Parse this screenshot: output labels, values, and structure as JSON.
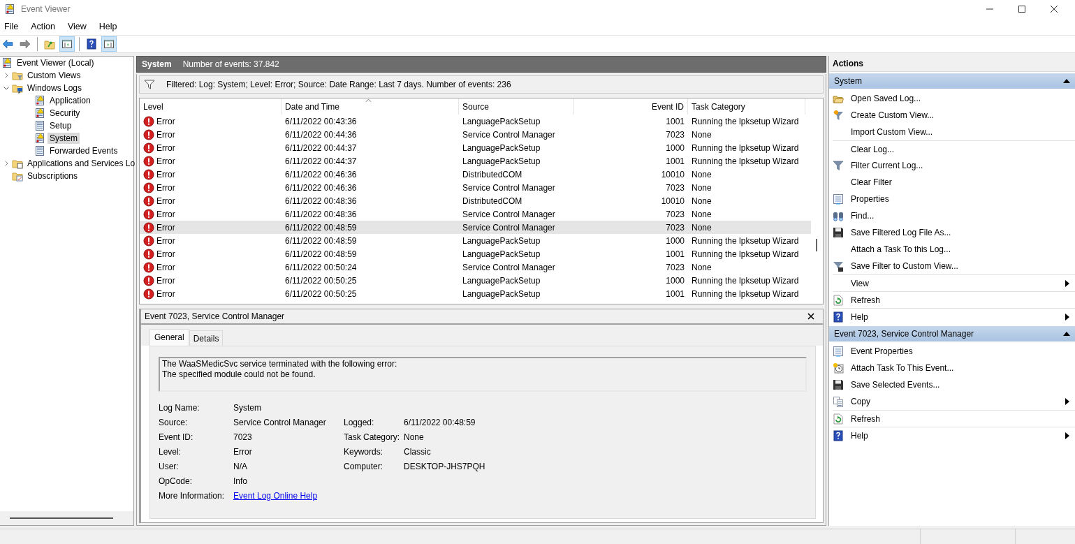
{
  "window": {
    "title": "Event Viewer"
  },
  "menu": [
    "File",
    "Action",
    "View",
    "Help"
  ],
  "toolbar": [
    {
      "kind": "back",
      "pressed": false
    },
    {
      "kind": "forward",
      "pressed": false
    },
    {
      "kind": "separator"
    },
    {
      "kind": "up",
      "pressed": false
    },
    {
      "kind": "tree",
      "pressed": true
    },
    {
      "kind": "separator"
    },
    {
      "kind": "help",
      "pressed": false
    },
    {
      "kind": "actions",
      "pressed": true
    }
  ],
  "tree": [
    {
      "label": "Event Viewer (Local)",
      "kind": "root",
      "selected": false,
      "children": [
        {
          "label": "Custom Views",
          "kind": "filterfolder",
          "expanded": false,
          "selected": false
        },
        {
          "label": "Windows Logs",
          "kind": "logfolder",
          "expanded": true,
          "selected": false,
          "children": [
            {
              "label": "Application",
              "kind": "warnlog",
              "selected": false
            },
            {
              "label": "Security",
              "kind": "warnlog",
              "selected": false
            },
            {
              "label": "Setup",
              "kind": "log",
              "selected": false
            },
            {
              "label": "System",
              "kind": "warnlog",
              "selected": true
            },
            {
              "label": "Forwarded Events",
              "kind": "log",
              "selected": false
            }
          ]
        },
        {
          "label": "Applications and Services Lo",
          "kind": "appfolder",
          "expanded": false,
          "selected": false
        },
        {
          "label": "Subscriptions",
          "kind": "subfolder",
          "selected": false
        }
      ]
    }
  ],
  "log_header": {
    "name": "System",
    "count": "Number of events: 37.842"
  },
  "filter_text": "Filtered: Log: System; Level: Error; Source: Date Range: Last 7 days. Number of events: 236",
  "table": {
    "columns": [
      {
        "label": "Level",
        "sorted": false
      },
      {
        "label": "Date and Time",
        "sorted": true
      },
      {
        "label": "Source",
        "sorted": false
      },
      {
        "label": "Event ID",
        "sorted": false
      },
      {
        "label": "Task Category",
        "sorted": false
      }
    ],
    "rows": [
      {
        "level": "Error",
        "date": "6/11/2022 00:43:36",
        "source": "LanguagePackSetup",
        "id": "1001",
        "category": "Running the lpksetup Wizard",
        "selected": false
      },
      {
        "level": "Error",
        "date": "6/11/2022 00:44:36",
        "source": "Service Control Manager",
        "id": "7023",
        "category": "None",
        "selected": false
      },
      {
        "level": "Error",
        "date": "6/11/2022 00:44:37",
        "source": "LanguagePackSetup",
        "id": "1000",
        "category": "Running the lpksetup Wizard",
        "selected": false
      },
      {
        "level": "Error",
        "date": "6/11/2022 00:44:37",
        "source": "LanguagePackSetup",
        "id": "1001",
        "category": "Running the lpksetup Wizard",
        "selected": false
      },
      {
        "level": "Error",
        "date": "6/11/2022 00:46:36",
        "source": "DistributedCOM",
        "id": "10010",
        "category": "None",
        "selected": false
      },
      {
        "level": "Error",
        "date": "6/11/2022 00:46:36",
        "source": "Service Control Manager",
        "id": "7023",
        "category": "None",
        "selected": false
      },
      {
        "level": "Error",
        "date": "6/11/2022 00:48:36",
        "source": "DistributedCOM",
        "id": "10010",
        "category": "None",
        "selected": false
      },
      {
        "level": "Error",
        "date": "6/11/2022 00:48:36",
        "source": "Service Control Manager",
        "id": "7023",
        "category": "None",
        "selected": false
      },
      {
        "level": "Error",
        "date": "6/11/2022 00:48:59",
        "source": "Service Control Manager",
        "id": "7023",
        "category": "None",
        "selected": true
      },
      {
        "level": "Error",
        "date": "6/11/2022 00:48:59",
        "source": "LanguagePackSetup",
        "id": "1000",
        "category": "Running the lpksetup Wizard",
        "selected": false
      },
      {
        "level": "Error",
        "date": "6/11/2022 00:48:59",
        "source": "LanguagePackSetup",
        "id": "1001",
        "category": "Running the lpksetup Wizard",
        "selected": false
      },
      {
        "level": "Error",
        "date": "6/11/2022 00:50:24",
        "source": "Service Control Manager",
        "id": "7023",
        "category": "None",
        "selected": false
      },
      {
        "level": "Error",
        "date": "6/11/2022 00:50:25",
        "source": "LanguagePackSetup",
        "id": "1000",
        "category": "Running the lpksetup Wizard",
        "selected": false
      },
      {
        "level": "Error",
        "date": "6/11/2022 00:50:25",
        "source": "LanguagePackSetup",
        "id": "1001",
        "category": "Running the lpksetup Wizard",
        "selected": false
      }
    ]
  },
  "details": {
    "title": "Event 7023, Service Control Manager",
    "tabs": [
      {
        "label": "General",
        "selected": true
      },
      {
        "label": "Details",
        "selected": false
      }
    ],
    "message": [
      "The WaaSMedicSvc service terminated with the following error:",
      "The specified module could not be found."
    ],
    "rows": [
      {
        "label": "Log Name:",
        "value": "System"
      },
      {
        "label": "Source:",
        "value": "Service Control Manager",
        "label_2": "Logged:",
        "value_2": "6/11/2022 00:48:59"
      },
      {
        "label": "Event ID:",
        "value": "7023",
        "label_2": "Task Category:",
        "value_2": "None"
      },
      {
        "label": "Level:",
        "value": "Error",
        "label_2": "Keywords:",
        "value_2": "Classic"
      },
      {
        "label": "User:",
        "value": "N/A",
        "label_2": "Computer:",
        "value_2": "DESKTOP-JHS7PQH"
      },
      {
        "label": "OpCode:",
        "value": "Info"
      }
    ],
    "more_info": {
      "label": "More Information:",
      "link": "Event Log Online Help"
    }
  },
  "actions": {
    "title": "Actions",
    "sections": [
      {
        "title": "System",
        "expanded": true,
        "items": [
          {
            "label": "Open Saved Log...",
            "kind": "folder",
            "submenu": false,
            "separator_before": false
          },
          {
            "label": "Create Custom View...",
            "kind": "funnelstar",
            "submenu": false,
            "separator_before": false
          },
          {
            "label": "Import Custom View...",
            "kind": "none",
            "submenu": false,
            "separator_before": false
          },
          {
            "label": "Clear Log...",
            "kind": "none",
            "submenu": false,
            "separator_before": true
          },
          {
            "label": "Filter Current Log...",
            "kind": "funnel",
            "submenu": false,
            "separator_before": false
          },
          {
            "label": "Clear Filter",
            "kind": "none",
            "submenu": false,
            "separator_before": false
          },
          {
            "label": "Properties",
            "kind": "properties",
            "submenu": false,
            "separator_before": false
          },
          {
            "label": "Find...",
            "kind": "binoculars",
            "submenu": false,
            "separator_before": false
          },
          {
            "label": "Save Filtered Log File As...",
            "kind": "disk",
            "submenu": false,
            "separator_before": false
          },
          {
            "label": "Attach a Task To this Log...",
            "kind": "none",
            "submenu": false,
            "separator_before": false
          },
          {
            "label": "Save Filter to Custom View...",
            "kind": "funneldisk",
            "submenu": false,
            "separator_before": false
          },
          {
            "label": "View",
            "kind": "none",
            "submenu": true,
            "separator_before": true
          },
          {
            "label": "Refresh",
            "kind": "refresh",
            "submenu": false,
            "separator_before": true
          },
          {
            "label": "Help",
            "kind": "help",
            "submenu": true,
            "separator_before": true
          }
        ]
      },
      {
        "title": "Event 7023, Service Control Manager",
        "expanded": true,
        "items": [
          {
            "label": "Event Properties",
            "kind": "properties",
            "submenu": false,
            "separator_before": false
          },
          {
            "label": "Attach Task To This Event...",
            "kind": "clock",
            "submenu": false,
            "separator_before": false
          },
          {
            "label": "Save Selected Events...",
            "kind": "disk",
            "submenu": false,
            "separator_before": false
          },
          {
            "label": "Copy",
            "kind": "copy",
            "submenu": true,
            "separator_before": false
          },
          {
            "label": "Refresh",
            "kind": "refresh",
            "submenu": false,
            "separator_before": true
          },
          {
            "label": "Help",
            "kind": "help",
            "submenu": true,
            "separator_before": true
          }
        ]
      }
    ]
  }
}
